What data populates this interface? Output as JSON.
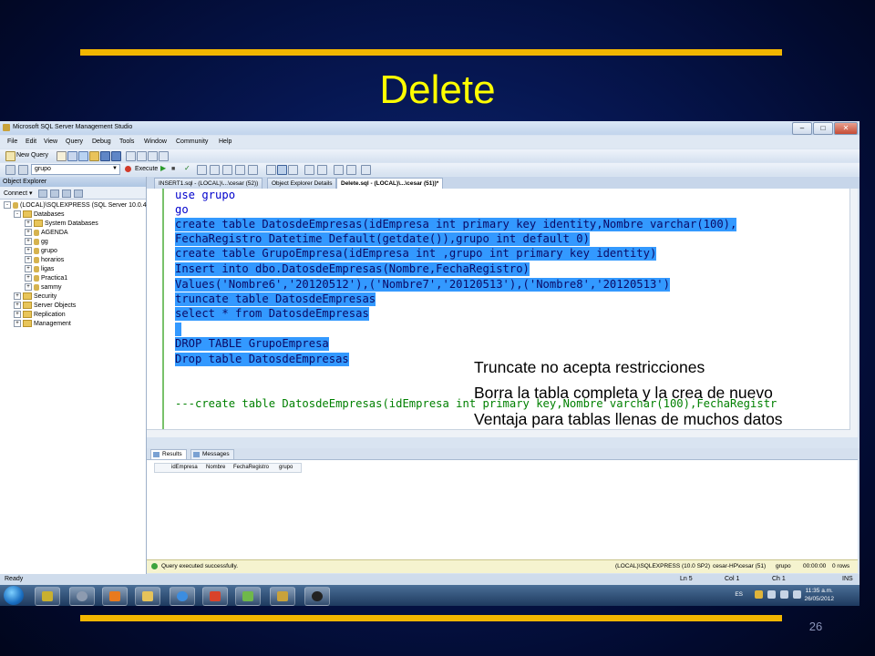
{
  "slide": {
    "title": "Delete",
    "page_number": "26",
    "accent_color": "#f2b600",
    "title_color": "#ffff00"
  },
  "window": {
    "title": "Microsoft SQL Server Management Studio",
    "controls": {
      "minimize": "–",
      "maximize": "□",
      "close": "✕"
    }
  },
  "menu": [
    "File",
    "Edit",
    "View",
    "Query",
    "Debug",
    "Tools",
    "Window",
    "Community",
    "Help"
  ],
  "toolbar": {
    "new_query": "New Query",
    "database": "grupo",
    "execute": "Execute",
    "check_mark": "✓"
  },
  "object_explorer": {
    "title": "Object Explorer",
    "connect": "Connect ▾",
    "server": "(LOCAL)\\SQLEXPRESS (SQL Server 10.0.406",
    "databases_folder": "Databases",
    "databases": [
      "System Databases",
      "AGENDA",
      "gg",
      "grupo",
      "horarios",
      "ligas",
      "Practica1",
      "sammy"
    ],
    "folders": [
      "Security",
      "Server Objects",
      "Replication",
      "Management"
    ]
  },
  "tabs": [
    {
      "label": "INSERT1.sql - (LOCAL)\\...\\cesar (52))"
    },
    {
      "label": "Object Explorer Details"
    },
    {
      "label": "Delete.sql - (LOCAL)\\...\\cesar (51))*"
    }
  ],
  "code_lines": [
    "use grupo",
    "go",
    "create table DatosdeEmpresas(idEmpresa int primary key identity,Nombre varchar(100),",
    "FechaRegistro Datetime Default(getdate()),grupo int default 0)",
    "create table GrupoEmpresa(idEmpresa int ,grupo int primary key identity)",
    "Insert into dbo.DatosdeEmpresas(Nombre,FechaRegistro)",
    "Values('Nombre6','20120512'),('Nombre7','20120513'),('Nombre8','20120513')",
    "truncate table DatosdeEmpresas",
    "select * from DatosdeEmpresas",
    " ",
    "DROP TABLE GrupoEmpresa",
    "Drop table DatosdeEmpresas",
    "---create table DatosdeEmpresas(idEmpresa int primary key,Nombre varchar(100),FechaRegistr"
  ],
  "results": {
    "tabs": [
      "Results",
      "Messages"
    ],
    "columns": [
      "idEmpresa",
      "Nombre",
      "FechaRegistro",
      "grupo"
    ]
  },
  "query_status": {
    "message": "Query executed successfully.",
    "server": "(LOCAL)\\SQLEXPRESS (10.0 SP2)",
    "user": "cesar-HP\\cesar (51)",
    "database": "grupo",
    "elapsed": "00:00:00",
    "rows": "0 rows"
  },
  "status_bar": {
    "state": "Ready",
    "line": "Ln 5",
    "col": "Col 1",
    "ch": "Ch 1",
    "mode": "INS"
  },
  "taskbar": {
    "language": "ES",
    "time": "11:35 a.m.",
    "date": "26/05/2012"
  },
  "notes": [
    "Truncate no acepta restricciones",
    "Borra la tabla completa y la crea de nuevo",
    "Ventaja para tablas llenas de muchos datos"
  ]
}
